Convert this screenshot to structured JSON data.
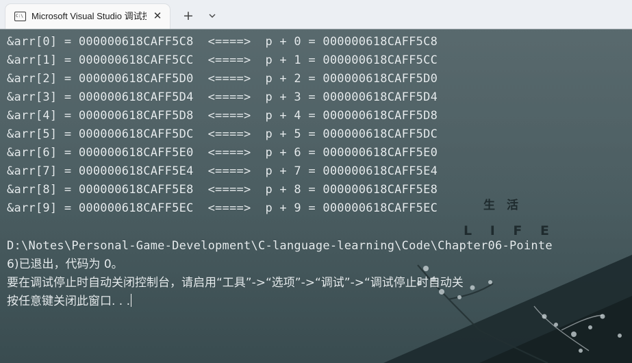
{
  "tab": {
    "icon": "console-app-icon",
    "title": "Microsoft Visual Studio 调试控制台",
    "close_icon": "close-icon",
    "new_tab_icon": "plus-icon",
    "dropdown_icon": "chevron-down-icon"
  },
  "console": {
    "address_lines": [
      "&arr[0] = 000000618CAFF5C8  <====>  p + 0 = 000000618CAFF5C8",
      "&arr[1] = 000000618CAFF5CC  <====>  p + 1 = 000000618CAFF5CC",
      "&arr[2] = 000000618CAFF5D0  <====>  p + 2 = 000000618CAFF5D0",
      "&arr[3] = 000000618CAFF5D4  <====>  p + 3 = 000000618CAFF5D4",
      "&arr[4] = 000000618CAFF5D8  <====>  p + 4 = 000000618CAFF5D8",
      "&arr[5] = 000000618CAFF5DC  <====>  p + 5 = 000000618CAFF5DC",
      "&arr[6] = 000000618CAFF5E0  <====>  p + 6 = 000000618CAFF5E0",
      "&arr[7] = 000000618CAFF5E4  <====>  p + 7 = 000000618CAFF5E4",
      "&arr[8] = 000000618CAFF5E8  <====>  p + 8 = 000000618CAFF5E8",
      "&arr[9] = 000000618CAFF5EC  <====>  p + 9 = 000000618CAFF5EC"
    ],
    "exit_path": "D:\\Notes\\Personal-Game-Development\\C-language-learning\\Code\\Chapter06-Pointe",
    "exit_message": "6)已退出，代码为 0。",
    "close_hint": "要在调试停止时自动关闭控制台，请启用“工具”->“选项”->“调试”->“调试停止时自动关",
    "press_key": "按任意键关闭此窗口. . ."
  },
  "background": {
    "chinese_text": "生　活",
    "english_text": "L I F E"
  },
  "colors": {
    "tab_bar": "#eceff3",
    "console_bg": "#4d6165",
    "console_text": "#e6ecee"
  }
}
